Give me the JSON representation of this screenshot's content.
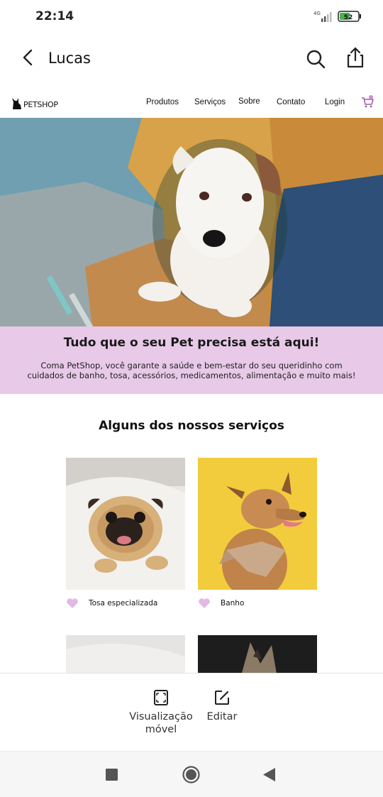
{
  "status": {
    "time": "22:14",
    "network": "4G",
    "battery": "52"
  },
  "app_bar": {
    "title": "Lucas",
    "back_icon": "back-arrow-icon",
    "search_icon": "search-icon",
    "share_icon": "share-icon"
  },
  "site": {
    "logo": {
      "text": "PETSHOP"
    },
    "nav": [
      {
        "label": "Produtos"
      },
      {
        "label": "Serviços"
      },
      {
        "label": "Sobre"
      },
      {
        "label": "Contato"
      },
      {
        "label": "Login"
      }
    ],
    "cart_icon": "cart-icon",
    "banner": {
      "title": "Tudo que o seu Pet precisa está aqui!",
      "text": "Coma  PetShop, você garante a saúde e bem-estar do seu queridinho com cuidados de banho, tosa, acessórios, medicamentos, alimentação e muito mais!"
    },
    "services_title": "Alguns dos nossos serviços",
    "services": [
      {
        "label": "Tosa especializada"
      },
      {
        "label": "Banho"
      }
    ],
    "accent_color": "#e8c9e8",
    "heart_color": "#e3b8e6"
  },
  "actions": [
    {
      "label": "Visualização\nmóvel",
      "icon": "fullscreen-icon"
    },
    {
      "label": "Editar",
      "icon": "edit-icon"
    }
  ]
}
